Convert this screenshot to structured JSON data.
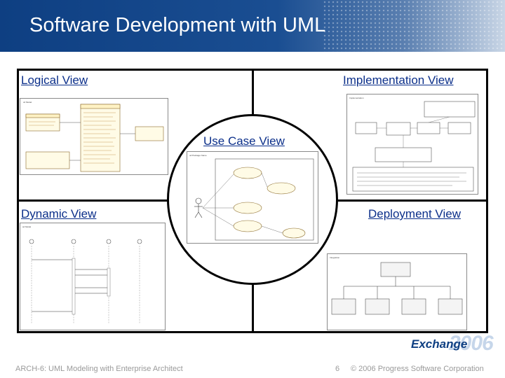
{
  "slide": {
    "title": "Software Development with UML"
  },
  "views": {
    "logical": "Logical View",
    "implementation": "Implementation View",
    "use_case": "Use Case View",
    "dynamic": "Dynamic View",
    "deployment": "Deployment View"
  },
  "footer": {
    "left": "ARCH-6: UML Modeling with Enterprise Architect",
    "page_number": "6",
    "copyright": "© 2006 Progress Software Corporation"
  },
  "logo": {
    "word": "Exchange",
    "year": "2006"
  },
  "colors": {
    "title_bar": "#0e3f82",
    "label_text": "#0b2f8a",
    "footer_text": "#9a9a9a"
  }
}
